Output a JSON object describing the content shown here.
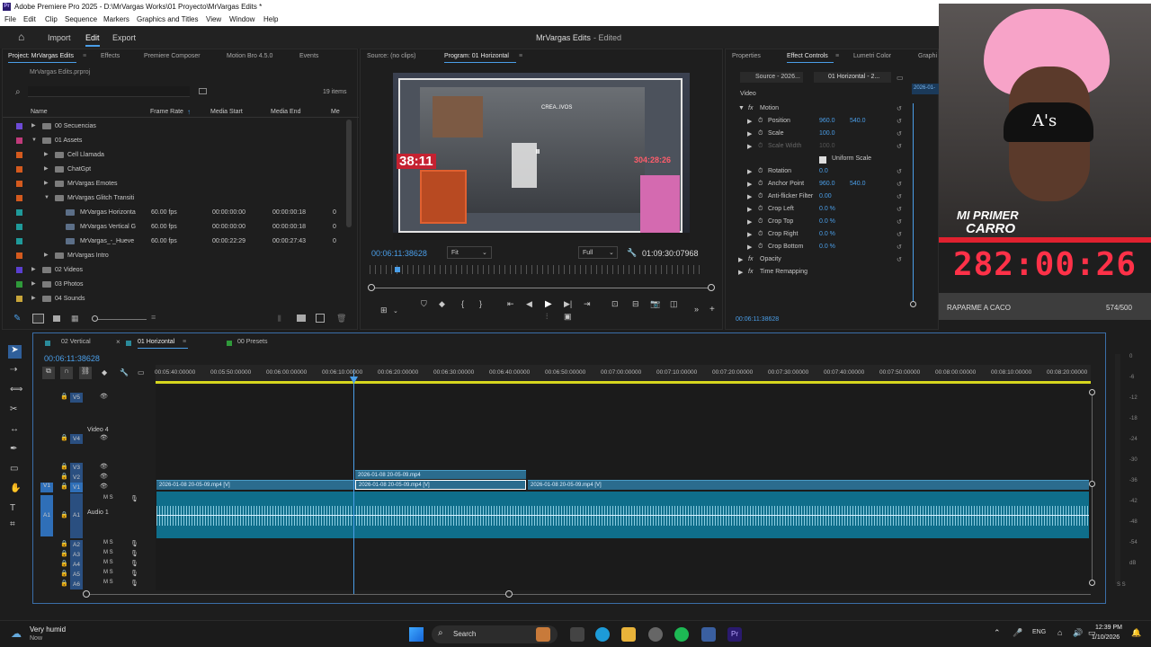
{
  "titlebar": {
    "title": "Adobe Premiere Pro 2025 - D:\\MrVargas Works\\01 Proyecto\\MrVargas Edits *"
  },
  "menu": [
    "File",
    "Edit",
    "Clip",
    "Sequence",
    "Markers",
    "Graphics and Titles",
    "View",
    "Window",
    "Help"
  ],
  "appbar": {
    "import": "Import",
    "edit": "Edit",
    "export": "Export",
    "project_title": "MrVargas Edits",
    "status": "- Edited"
  },
  "project": {
    "tabs": [
      "Project: MrVargas Edits",
      "Effects",
      "Premiere Composer",
      "Motion Bro 4.5.0",
      "Events"
    ],
    "filename": "MrVargas Edits.prproj",
    "count": "19 items",
    "columns": [
      "Name",
      "Frame Rate",
      "Media Start",
      "Media End",
      "Me"
    ],
    "rows": [
      {
        "name": "00 Secuencias",
        "fr": "",
        "ms": "",
        "me": "",
        "extra": "",
        "color": "#6d4bd6",
        "indent": 0,
        "kind": "folder",
        "open": false
      },
      {
        "name": "01 Assets",
        "fr": "",
        "ms": "",
        "me": "",
        "extra": "",
        "color": "#c03a7a",
        "indent": 0,
        "kind": "folder",
        "open": true
      },
      {
        "name": "Cell Llamada",
        "fr": "",
        "ms": "",
        "me": "",
        "extra": "",
        "color": "#d45a1e",
        "indent": 1,
        "kind": "folder",
        "open": false
      },
      {
        "name": "ChatGpt",
        "fr": "",
        "ms": "",
        "me": "",
        "extra": "",
        "color": "#d45a1e",
        "indent": 1,
        "kind": "folder",
        "open": false
      },
      {
        "name": "MrVargas Emotes",
        "fr": "",
        "ms": "",
        "me": "",
        "extra": "",
        "color": "#d45a1e",
        "indent": 1,
        "kind": "folder",
        "open": false
      },
      {
        "name": "MrVargas Glitch Transiti",
        "fr": "",
        "ms": "",
        "me": "",
        "extra": "",
        "color": "#d45a1e",
        "indent": 1,
        "kind": "folder",
        "open": true
      },
      {
        "name": "MrVargas Horizonta",
        "fr": "60.00 fps",
        "ms": "00:00:00:00",
        "me": "00:00:00:18",
        "extra": "0",
        "color": "#1f9a9a",
        "indent": 2,
        "kind": "seq",
        "open": false
      },
      {
        "name": "MrVargas Vertical G",
        "fr": "60.00 fps",
        "ms": "00:00:00:00",
        "me": "00:00:00:18",
        "extra": "0",
        "color": "#1f9a9a",
        "indent": 2,
        "kind": "seq",
        "open": false
      },
      {
        "name": "MrVargas_-_Hueve",
        "fr": "60.00 fps",
        "ms": "00:00:22:29",
        "me": "00:00:27:43",
        "extra": "0",
        "color": "#1f9a9a",
        "indent": 2,
        "kind": "seq",
        "open": false
      },
      {
        "name": "MrVargas Intro",
        "fr": "",
        "ms": "",
        "me": "",
        "extra": "",
        "color": "#d45a1e",
        "indent": 1,
        "kind": "folder",
        "open": false
      },
      {
        "name": "02 Videos",
        "fr": "",
        "ms": "",
        "me": "",
        "extra": "",
        "color": "#5a3fd0",
        "indent": 0,
        "kind": "folder",
        "open": false
      },
      {
        "name": "03 Photos",
        "fr": "",
        "ms": "",
        "me": "",
        "extra": "",
        "color": "#2f9a3a",
        "indent": 0,
        "kind": "folder",
        "open": false
      },
      {
        "name": "04 Sounds",
        "fr": "",
        "ms": "",
        "me": "",
        "extra": "",
        "color": "#c8a53a",
        "indent": 0,
        "kind": "folder",
        "open": false
      }
    ]
  },
  "monitor": {
    "source_tab": "Source: (no clips)",
    "program_tab": "Program: 01 Horizontal",
    "timecode": "00:06:11:38628",
    "fit": "Fit",
    "full": "Full",
    "duration": "01:09:30:07968",
    "preview_timer": "38:11",
    "preview_right": "304:28:26",
    "preview_center": "CREA..IVOS"
  },
  "effects": {
    "tabs": [
      "Properties",
      "Effect Controls",
      "Lumetri Color",
      "Graphi"
    ],
    "source": "Source - 2026...",
    "sequence": "01 Horizontal - 2...",
    "clip_label": "2026-01-",
    "video": "Video",
    "rows": [
      {
        "label": "Motion",
        "v1": "",
        "v2": "",
        "fx": true,
        "sub": false,
        "disabled": false
      },
      {
        "label": "Position",
        "v1": "960.0",
        "v2": "540.0",
        "fx": false,
        "sub": true,
        "disabled": false
      },
      {
        "label": "Scale",
        "v1": "100.0",
        "v2": "",
        "fx": false,
        "sub": true,
        "disabled": false
      },
      {
        "label": "Scale Width",
        "v1": "100.0",
        "v2": "",
        "fx": false,
        "sub": true,
        "disabled": true
      },
      {
        "label": "Uniform Scale",
        "v1": "",
        "v2": "",
        "fx": false,
        "sub": true,
        "disabled": false
      },
      {
        "label": "Rotation",
        "v1": "0.0",
        "v2": "",
        "fx": false,
        "sub": true,
        "disabled": false
      },
      {
        "label": "Anchor Point",
        "v1": "960.0",
        "v2": "540.0",
        "fx": false,
        "sub": true,
        "disabled": false
      },
      {
        "label": "Anti-flicker Filter",
        "v1": "0.00",
        "v2": "",
        "fx": false,
        "sub": true,
        "disabled": false
      },
      {
        "label": "Crop Left",
        "v1": "0.0 %",
        "v2": "",
        "fx": false,
        "sub": true,
        "disabled": false
      },
      {
        "label": "Crop Top",
        "v1": "0.0 %",
        "v2": "",
        "fx": false,
        "sub": true,
        "disabled": false
      },
      {
        "label": "Crop Right",
        "v1": "0.0 %",
        "v2": "",
        "fx": false,
        "sub": true,
        "disabled": false
      },
      {
        "label": "Crop Bottom",
        "v1": "0.0 %",
        "v2": "",
        "fx": false,
        "sub": true,
        "disabled": false
      },
      {
        "label": "Opacity",
        "v1": "",
        "v2": "",
        "fx": true,
        "sub": false,
        "disabled": false
      },
      {
        "label": "Time Remapping",
        "v1": "",
        "v2": "",
        "fx": true,
        "sub": false,
        "disabled": false
      }
    ],
    "timecode": "00:06:11:38628"
  },
  "webcam": {
    "cap": "MI PRIMER",
    "cap2": "CARRO",
    "counter": "282:00:26",
    "status": "RAPARME A CACO",
    "progress_text": "574/500",
    "hat": "A's"
  },
  "timeline": {
    "tabs": [
      "02 Vertical",
      "01 Horizontal",
      "00 Presets"
    ],
    "timecode": "00:06:11:38628",
    "ruler": [
      "00:05:40:00000",
      "00:05:50:00000",
      "00:06:00:00000",
      "00:06:10:00000",
      "00:06:20:00000",
      "00:06:30:00000",
      "00:06:40:00000",
      "00:06:50:00000",
      "00:07:00:00000",
      "00:07:10:00000",
      "00:07:20:00000",
      "00:07:30:00000",
      "00:07:40:00000",
      "00:07:50:00000",
      "00:08:00:00000",
      "00:08:10:00000",
      "00:08:20:00000"
    ],
    "tracks_video": [
      "V5",
      "V4",
      "V3",
      "V2",
      "V1"
    ],
    "video4": "Video 4",
    "tracks_audio": [
      "A1",
      "A2",
      "A3",
      "A4",
      "A5",
      "A6"
    ],
    "audio1": "Audio 1",
    "clip_v2": "2026-01-08 20-05-09.mp4",
    "clip_v1a": "2026-01-08 20-05-09.mp4 [V]",
    "clip_v1b": "2026-01-08 20-05-09.mp4 [V]",
    "clip_v1c": "2026-01-08 20-05-09.mp4 [V]",
    "meter": [
      "0",
      "-6",
      "-12",
      "-18",
      "-24",
      "-30",
      "-36",
      "-42",
      "-48",
      "-54",
      "dB"
    ],
    "ss": "S  S"
  },
  "taskbar": {
    "weather": "Very humid",
    "weather_sub": "Now",
    "search": "Search",
    "lang": "ENG",
    "time": "12:39 PM",
    "date": "1/10/2026"
  }
}
